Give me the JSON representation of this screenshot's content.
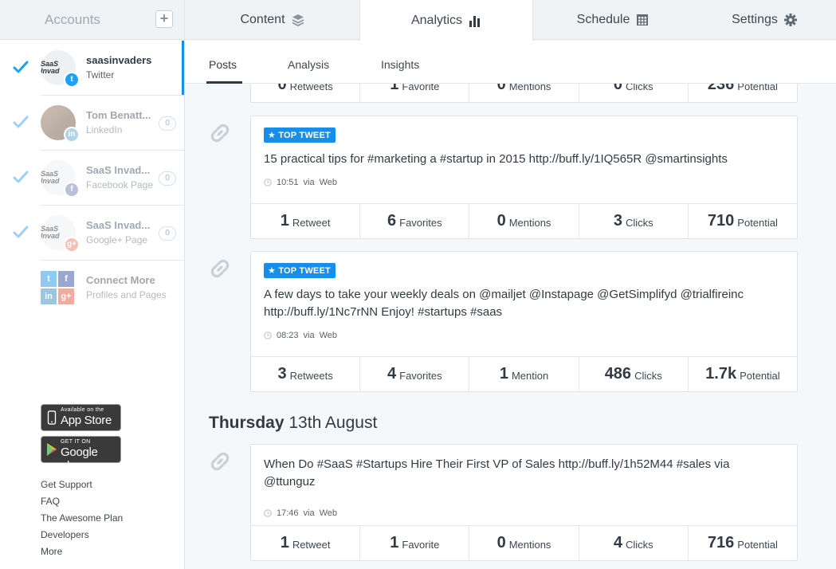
{
  "sidebar": {
    "title": "Accounts",
    "add_label": "+",
    "accounts": [
      {
        "name": "saasinvaders",
        "network": "Twitter",
        "avatar_text": "SaaS Invad",
        "badge": ""
      },
      {
        "name": "Tom Benatt...",
        "network": "LinkedIn",
        "avatar_text": "",
        "badge": "0"
      },
      {
        "name": "SaaS Invad...",
        "network": "Facebook Page",
        "avatar_text": "SaaS Invad",
        "badge": "0"
      },
      {
        "name": "SaaS Invad...",
        "network": "Google+ Page",
        "avatar_text": "SaaS Invad",
        "badge": "0"
      }
    ],
    "connect": {
      "title": "Connect More",
      "subtitle": "Profiles and Pages"
    },
    "app_store": {
      "small": "Available on the",
      "big": "App Store"
    },
    "google_play": {
      "small": "GET IT ON",
      "big": "Google play"
    },
    "links": [
      "Get Support",
      "FAQ",
      "The Awesome Plan",
      "Developers",
      "More"
    ]
  },
  "tabs": [
    {
      "label": "Content",
      "icon": "layers-icon"
    },
    {
      "label": "Analytics",
      "icon": "bar-chart-icon"
    },
    {
      "label": "Schedule",
      "icon": "calendar-icon"
    },
    {
      "label": "Settings",
      "icon": "gear-icon"
    }
  ],
  "subtabs": [
    "Posts",
    "Analysis",
    "Insights"
  ],
  "partial_stats": [
    {
      "num": "0",
      "lbl": "Retweets"
    },
    {
      "num": "1",
      "lbl": "Favorite"
    },
    {
      "num": "0",
      "lbl": "Mentions"
    },
    {
      "num": "0",
      "lbl": "Clicks"
    },
    {
      "num": "236",
      "lbl": "Potential"
    }
  ],
  "posts": [
    {
      "badge": "TOP TWEET",
      "text": "15 practical tips for #marketing a #startup in 2015 http://buff.ly/1IQ565R  @smartinsights",
      "time": "10:51",
      "via": "via",
      "source": "Web",
      "stats": [
        {
          "num": "1",
          "lbl": "Retweet"
        },
        {
          "num": "6",
          "lbl": "Favorites"
        },
        {
          "num": "0",
          "lbl": "Mentions"
        },
        {
          "num": "3",
          "lbl": "Clicks"
        },
        {
          "num": "710",
          "lbl": "Potential"
        }
      ]
    },
    {
      "badge": "TOP TWEET",
      "text": "A few days to take your weekly deals on @mailjet @Instapage @GetSimplifyd @trialfireinc http://buff.ly/1Nc7rNN Enjoy! #startups #saas",
      "time": "08:23",
      "via": "via",
      "source": "Web",
      "stats": [
        {
          "num": "3",
          "lbl": "Retweets"
        },
        {
          "num": "4",
          "lbl": "Favorites"
        },
        {
          "num": "1",
          "lbl": "Mention"
        },
        {
          "num": "486",
          "lbl": "Clicks"
        },
        {
          "num": "1.7k",
          "lbl": "Potential"
        }
      ]
    },
    {
      "badge": "",
      "text": "When Do #SaaS #Startups Hire Their First VP of Sales  http://buff.ly/1h52M44  #sales via @ttunguz",
      "time": "17:46",
      "via": "via",
      "source": "Web",
      "stats": [
        {
          "num": "1",
          "lbl": "Retweet"
        },
        {
          "num": "1",
          "lbl": "Favorite"
        },
        {
          "num": "0",
          "lbl": "Mentions"
        },
        {
          "num": "4",
          "lbl": "Clicks"
        },
        {
          "num": "716",
          "lbl": "Potential"
        }
      ]
    }
  ],
  "day_heading": {
    "day": "Thursday",
    "date": "13th August"
  },
  "colors": {
    "accent": "#168eea",
    "text": "#323b43",
    "muted": "#a0a8b0"
  }
}
